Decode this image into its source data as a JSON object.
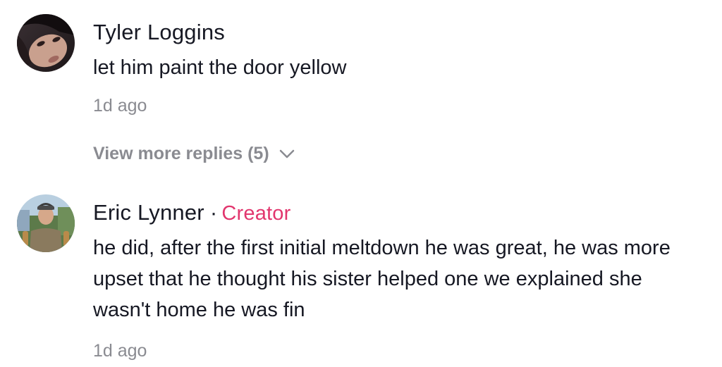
{
  "comments": [
    {
      "author": "Tyler Loggins",
      "text": "let him paint the door yellow",
      "time": "1d ago",
      "avatar_icon": "profile-photo"
    },
    {
      "author": "Eric Lynner",
      "separator": "·",
      "badge": "Creator",
      "text": "he did, after the first initial meltdown he was great, he was more upset that he thought his sister helped one we explained she wasn't home he was fin",
      "time": "1d ago",
      "avatar_icon": "profile-photo"
    }
  ],
  "replies_toggle": {
    "label": "View more replies (5)",
    "icon": "chevron-down-icon"
  },
  "colors": {
    "text": "#161823",
    "secondary": "#8a8b91",
    "creator": "#e2366e"
  }
}
